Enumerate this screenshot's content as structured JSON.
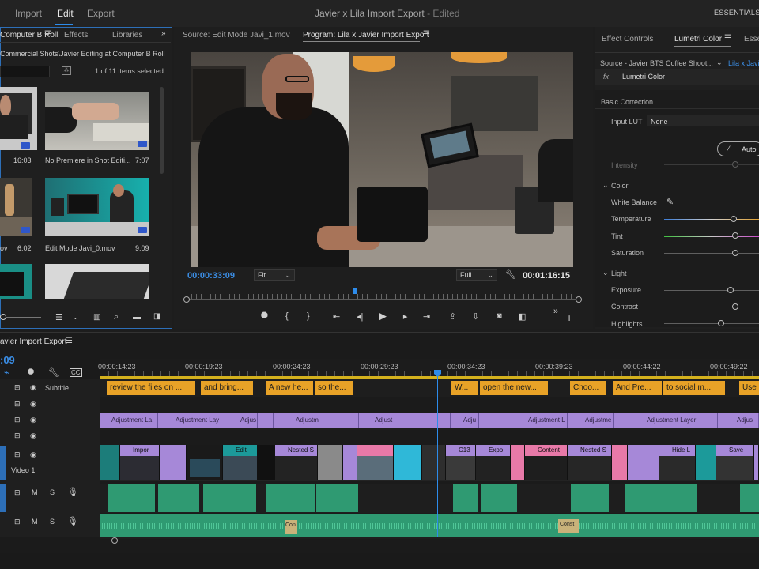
{
  "topbar": {
    "nav": [
      "Import",
      "Edit",
      "Export"
    ],
    "title": "Javier x Lila Import Export",
    "title_suffix": "- Edited",
    "workspace": "ESSENTIALS"
  },
  "project_panel": {
    "tabs": [
      "Computer B Roll",
      "Effects",
      "Libraries"
    ],
    "path": "Commercial Shots\\Javier Editing at Computer B Roll",
    "selection_count": "1 of 11 items selected",
    "clips": [
      {
        "name": "",
        "duration": "16:03"
      },
      {
        "name": "No Premiere in Shot Editi...",
        "duration": "7:07"
      },
      {
        "name": "ov",
        "duration": "6:02"
      },
      {
        "name": "Edit Mode Javi_0.mov",
        "duration": "9:09"
      }
    ]
  },
  "monitor": {
    "source_tab": "Source: Edit Mode Javi_1.mov",
    "program_tab": "Program: Lila x Javier Import Export",
    "current_time": "00:00:33:09",
    "zoom": "Fit",
    "quality": "Full",
    "duration": "00:01:16:15",
    "playhead_fraction": 0.43
  },
  "effects_panel": {
    "tabs": [
      "Effect Controls",
      "Lumetri Color",
      "Esse"
    ],
    "source_label": "Source - Javier BTS Coffee Shoot...",
    "target_label": "Lila x Javi",
    "fx_name": "Lumetri Color",
    "section_basic": "Basic Correction",
    "input_lut_label": "Input LUT",
    "input_lut_value": "None",
    "auto_button": "Auto",
    "intensity_label": "Intensity",
    "color_section": "Color",
    "white_balance": "White Balance",
    "sliders_color": [
      {
        "label": "Temperature",
        "value": 0.5
      },
      {
        "label": "Tint",
        "value": 0.5
      },
      {
        "label": "Saturation",
        "value": 0.5
      }
    ],
    "light_section": "Light",
    "sliders_light": [
      {
        "label": "Exposure",
        "value": 0.5
      },
      {
        "label": "Contrast",
        "value": 0.5
      },
      {
        "label": "Highlights",
        "value": 0.4
      }
    ]
  },
  "timeline": {
    "sequence_name": "avier Import Export",
    "current_time": ":09",
    "ruler": [
      "00:00:14:23",
      "00:00:19:23",
      "00:00:24:23",
      "00:00:29:23",
      "00:00:34:23",
      "00:00:39:23",
      "00:00:44:22",
      "00:00:49:22"
    ],
    "subtitle_track": "Subtitle",
    "video1_label": "Video 1",
    "captions": [
      "review the files on ...",
      "and bring...",
      "A new he...",
      "so the...",
      "W...",
      "open the new...",
      "Choo...",
      "And Pre...",
      "to social m...",
      "Use"
    ],
    "adjustments": [
      "Adjustment La",
      "Adjustment Lay",
      "Adjus",
      "Adjustm",
      "Adjust",
      "Adju",
      "Adjustment L",
      "Adjustme",
      "Adjustment Layer",
      "Adjus"
    ],
    "video_clips": [
      "Impor",
      "Edit",
      "Nested S",
      "C13",
      "Expo",
      "Content",
      "Nested S",
      "Hide L",
      "Save"
    ],
    "audio_labels": [
      "Con",
      "Const"
    ]
  },
  "colors": {
    "accent": "#2d8ceb",
    "caption": "#e8a227",
    "adjustment": "#a688d8",
    "audio": "#2f9a72",
    "pink": "#e879a8"
  }
}
